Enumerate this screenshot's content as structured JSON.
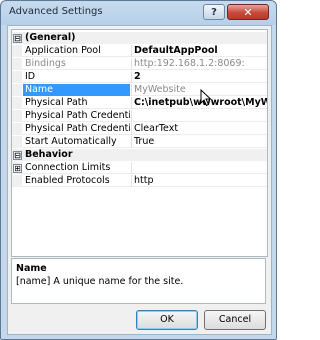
{
  "window": {
    "title": "Advanced Settings",
    "help_label": "?",
    "close_label": "✕"
  },
  "grid": {
    "categories": [
      {
        "label": "(General)",
        "expander": "⊟"
      },
      {
        "label": "Behavior",
        "expander": "⊟"
      }
    ],
    "properties": [
      {
        "name": "Application Pool",
        "value": "DefaultAppPool"
      },
      {
        "name": "Bindings",
        "value": "http:192.168.1.2:8069:"
      },
      {
        "name": "ID",
        "value": "2"
      },
      {
        "name": "Name",
        "value": "MyWebsite"
      },
      {
        "name": "Physical Path",
        "value": "C:\\inetpub\\wwwroot\\MyWebs"
      },
      {
        "name": "Physical Path Credentials",
        "value": ""
      },
      {
        "name": "Physical Path Credentials Logon Type",
        "value": "ClearText"
      },
      {
        "name": "Start Automatically",
        "value": "True"
      },
      {
        "name": "Connection Limits",
        "value": "",
        "expander": "⊞"
      },
      {
        "name": "Enabled Protocols",
        "value": "http"
      }
    ]
  },
  "description": {
    "title": "Name",
    "text": "[name] A unique name for the site."
  },
  "buttons": {
    "ok": "OK",
    "cancel": "Cancel"
  }
}
